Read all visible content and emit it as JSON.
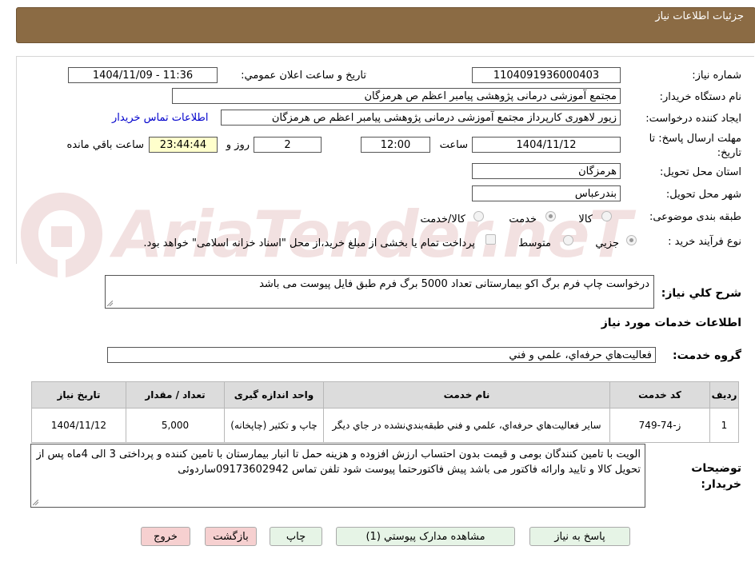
{
  "header": {
    "title": "جزئيات اطلاعات نياز"
  },
  "form": {
    "need_number_label": "شماره نياز:",
    "need_number": "1104091936000403",
    "announce_label": "تاريخ و ساعت اعلان عمومي:",
    "announce_value": "1404/11/09 - 11:36",
    "buyer_org_label": "نام دستگاه خريدار:",
    "buyer_org": "مجتمع آموزشی درمانی پژوهشی پیامبر اعظم ص  هرمزگان",
    "requester_label": "ايجاد كننده درخواست:",
    "requester": "زیور لاهوری کارپرداز مجتمع آموزشی درمانی پژوهشی پیامبر اعظم ص  هرمزگان",
    "contact_link": "اطلاعات تماس خريدار",
    "deadline_label": "مهلت ارسال پاسخ: تا تاريخ:",
    "deadline_date": "1404/11/12",
    "time_label": "ساعت",
    "deadline_time": "12:00",
    "days_value": "2",
    "days_label": "روز و",
    "remaining_time": "23:44:44",
    "remaining_label": "ساعت باقي مانده",
    "province_label": "استان محل تحويل:",
    "province": "هرمزگان",
    "city_label": "شهر محل تحويل:",
    "city": "بندرعباس",
    "category_label": "طبقه بندی موضوعی:",
    "category_options": [
      "كالا",
      "خدمت",
      "كالا/خدمت"
    ],
    "process_label": "نوع فرآيند خريد :",
    "process_options": [
      "جزيي",
      "متوسط"
    ],
    "payment_note": "پرداخت تمام يا بخشی از مبلغ خريد،از محل \"اسناد خزانه اسلامی\" خواهد بود."
  },
  "summary": {
    "label": "شرح كلي نياز:",
    "text": "درخواست چاپ فرم برگ اکو بیمارستانی تعداد 5000 برگ فرم طبق فایل پیوست می باشد"
  },
  "services": {
    "section_title": "اطلاعات خدمات مورد نياز",
    "group_label": "گروه خدمت:",
    "group_value": "فعاليت‌هاي حرفه‌اي، علمي و فني",
    "table": {
      "headers": [
        "رديف",
        "كد خدمت",
        "نام خدمت",
        "واحد اندازه گيری",
        "تعداد / مقدار",
        "تاريخ نياز"
      ],
      "rows": [
        [
          "1",
          "ز-74-749",
          "ساير فعاليت‌هاي حرفه‌اي، علمي و فني طبقه‌بندي‌نشده در جاي ديگر",
          "چاپ و تکثیر (چاپخانه)",
          "5,000",
          "1404/11/12"
        ]
      ]
    }
  },
  "buyer_notes": {
    "label": "توضيحات خريدار:",
    "text": "الویت با تامین کنندگان بومی و قیمت بدون احتساب ارزش افزوده و هزینه حمل تا انبار بیمارستان با تامین کننده و پرداختی  3 الی 4ماه پس از تحویل کالا و تایید وارائه فاکتور می باشد پیش فاکتورحتما پیوست شود تلفن تماس 09173602942ساردوئی"
  },
  "buttons": {
    "respond": "پاسخ به نياز",
    "attachments": "مشاهده مدارک پيوستي (1)",
    "print": "چاپ",
    "back": "بازگشت",
    "exit": "خروج"
  },
  "watermark": {
    "text": "AriaTender.neT"
  },
  "colors": {
    "header_bg": "#8b6b44",
    "link": "#0000cc",
    "remaining_bg": "#ffffcc"
  }
}
